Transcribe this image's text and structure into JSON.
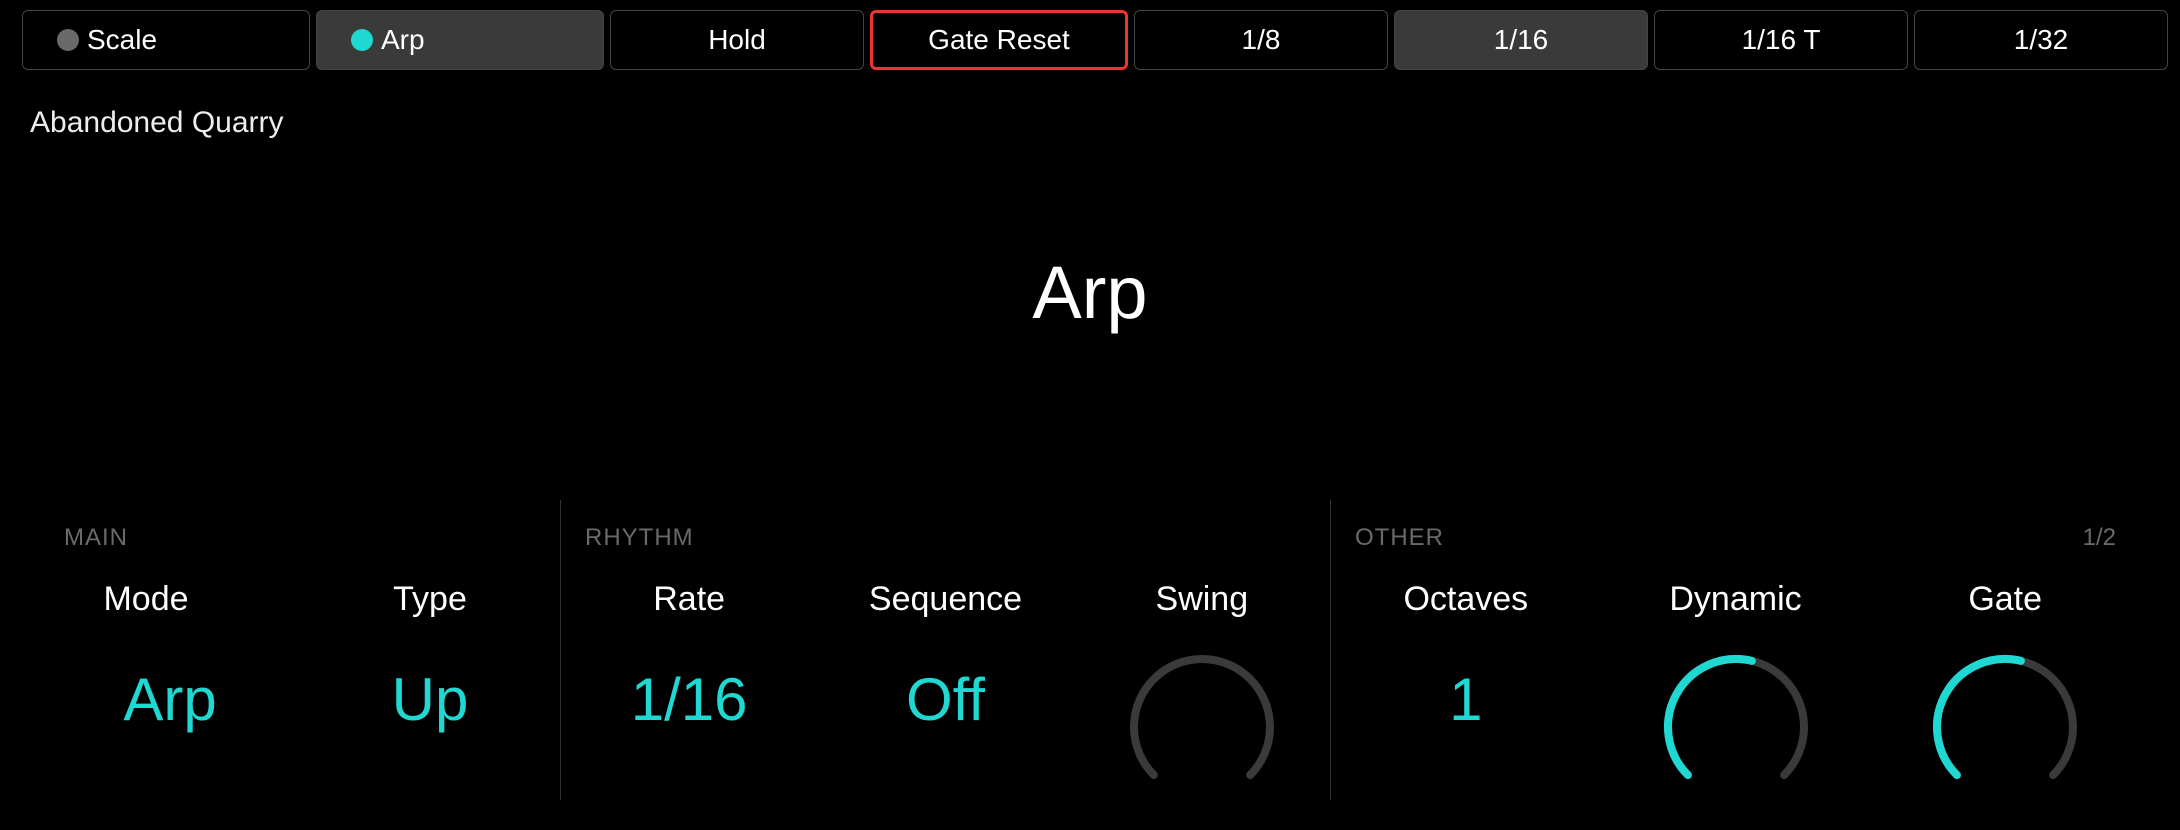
{
  "colors": {
    "accent": "#1fd8d2",
    "inactiveDot": "#6a6a6a",
    "highlight": "#e33"
  },
  "toolbar": [
    {
      "label": "Scale",
      "dot": "#6a6a6a",
      "active": false,
      "highlighted": false
    },
    {
      "label": "Arp",
      "dot": "#1fd8d2",
      "active": true,
      "highlighted": false
    },
    {
      "label": "Hold",
      "dot": null,
      "active": false,
      "highlighted": false
    },
    {
      "label": "Gate Reset",
      "dot": null,
      "active": false,
      "highlighted": true
    },
    {
      "label": "1/8",
      "dot": null,
      "active": false,
      "highlighted": false
    },
    {
      "label": "1/16",
      "dot": null,
      "active": true,
      "highlighted": false
    },
    {
      "label": "1/16 T",
      "dot": null,
      "active": false,
      "highlighted": false
    },
    {
      "label": "1/32",
      "dot": null,
      "active": false,
      "highlighted": false
    }
  ],
  "preset_name": "Abandoned Quarry",
  "section_title": "Arp",
  "page_indicator": "1/2",
  "groups": {
    "main": {
      "title": "MAIN",
      "params": [
        {
          "label": "Mode",
          "value": "Arp",
          "kind": "text",
          "color": "cyan"
        },
        {
          "label": "Type",
          "value": "Up",
          "kind": "text",
          "color": "cyan"
        }
      ]
    },
    "rhythm": {
      "title": "RHYTHM",
      "params": [
        {
          "label": "Rate",
          "value": "1/16",
          "kind": "text",
          "color": "cyan"
        },
        {
          "label": "Sequence",
          "value": "Off",
          "kind": "text",
          "color": "cyan"
        },
        {
          "label": "Swing",
          "value": 0.0,
          "kind": "knob",
          "color": "gray"
        }
      ]
    },
    "other": {
      "title": "OTHER",
      "params": [
        {
          "label": "Octaves",
          "value": "1",
          "kind": "text",
          "color": "cyan"
        },
        {
          "label": "Dynamic",
          "value": 0.55,
          "kind": "knob",
          "color": "cyan"
        },
        {
          "label": "Gate",
          "value": 0.55,
          "kind": "knob",
          "color": "cyan"
        }
      ]
    }
  }
}
